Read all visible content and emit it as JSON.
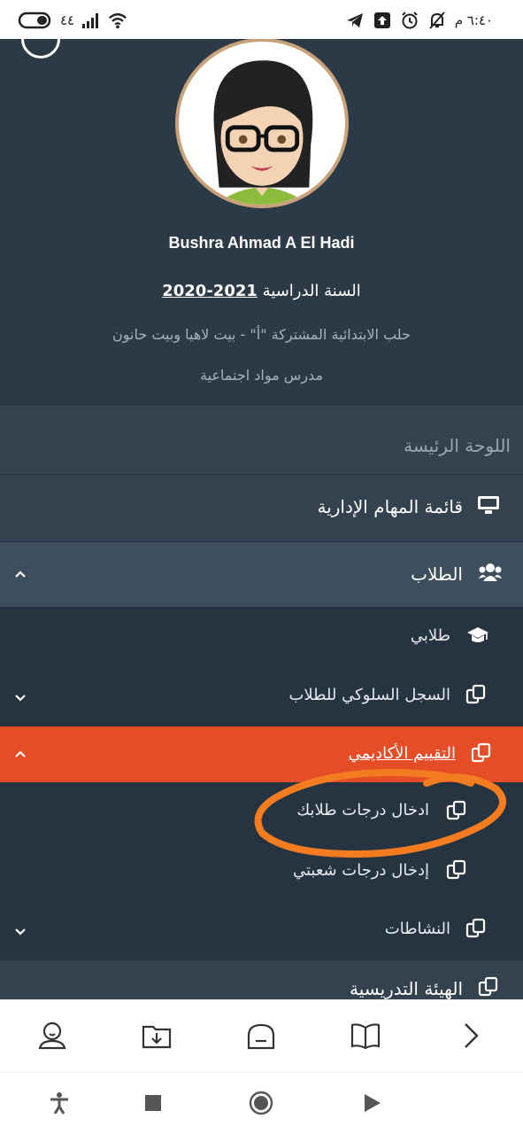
{
  "status_bar": {
    "time": "٦:٤٠ م",
    "battery": "٤٤",
    "icons": [
      "telegram-icon",
      "upload-icon",
      "alarm-icon",
      "mute-icon",
      "signal-icon",
      "wifi-icon",
      "battery-icon"
    ]
  },
  "profile": {
    "avatar": "avatar-icon",
    "name": "Bushra Ahmad A El Hadi",
    "year_label": "السنة الدراسية",
    "year_value": "2021-2020",
    "school": "حلب الابتدائية المشتركة \"أ\" - بيت لاهيا وبيت حانون",
    "role": "مدرس مواد اجتماعية"
  },
  "menu": {
    "section_title": "اللوحة الرئيسة",
    "items": [
      {
        "label": "قائمة المهام الإدارية",
        "icon": "monitor-icon"
      },
      {
        "label": "الطلاب",
        "icon": "users-icon",
        "chevron": "chevron-up-icon"
      },
      {
        "label": "طلابي",
        "icon": "graduation-cap-icon"
      },
      {
        "label": "السجل السلوكي للطلاب",
        "icon": "copy-icon",
        "chevron": "chevron-down-icon"
      },
      {
        "label": "التقييم الأكاديمي",
        "icon": "copy-icon",
        "chevron": "chevron-up-icon"
      },
      {
        "label": "ادخال درجات طلابك",
        "icon": "copy-icon"
      },
      {
        "label": "إدخال درجات شعبتي",
        "icon": "copy-icon"
      },
      {
        "label": "النشاطات",
        "icon": "copy-icon",
        "chevron": "chevron-down-icon"
      },
      {
        "label": "الهيئة التدريسية",
        "icon": "copy-icon"
      }
    ]
  },
  "colors": {
    "drawer_bg": "#2c3a47",
    "active_bg": "#e44d26",
    "annotation": "#f47c20"
  },
  "bottom_nav": [
    "user-icon",
    "folder-download-icon",
    "home-icon",
    "book-icon",
    "chevron-right-icon"
  ],
  "system_nav": [
    "accessibility-icon",
    "stop-icon",
    "record-icon",
    "play-icon"
  ]
}
